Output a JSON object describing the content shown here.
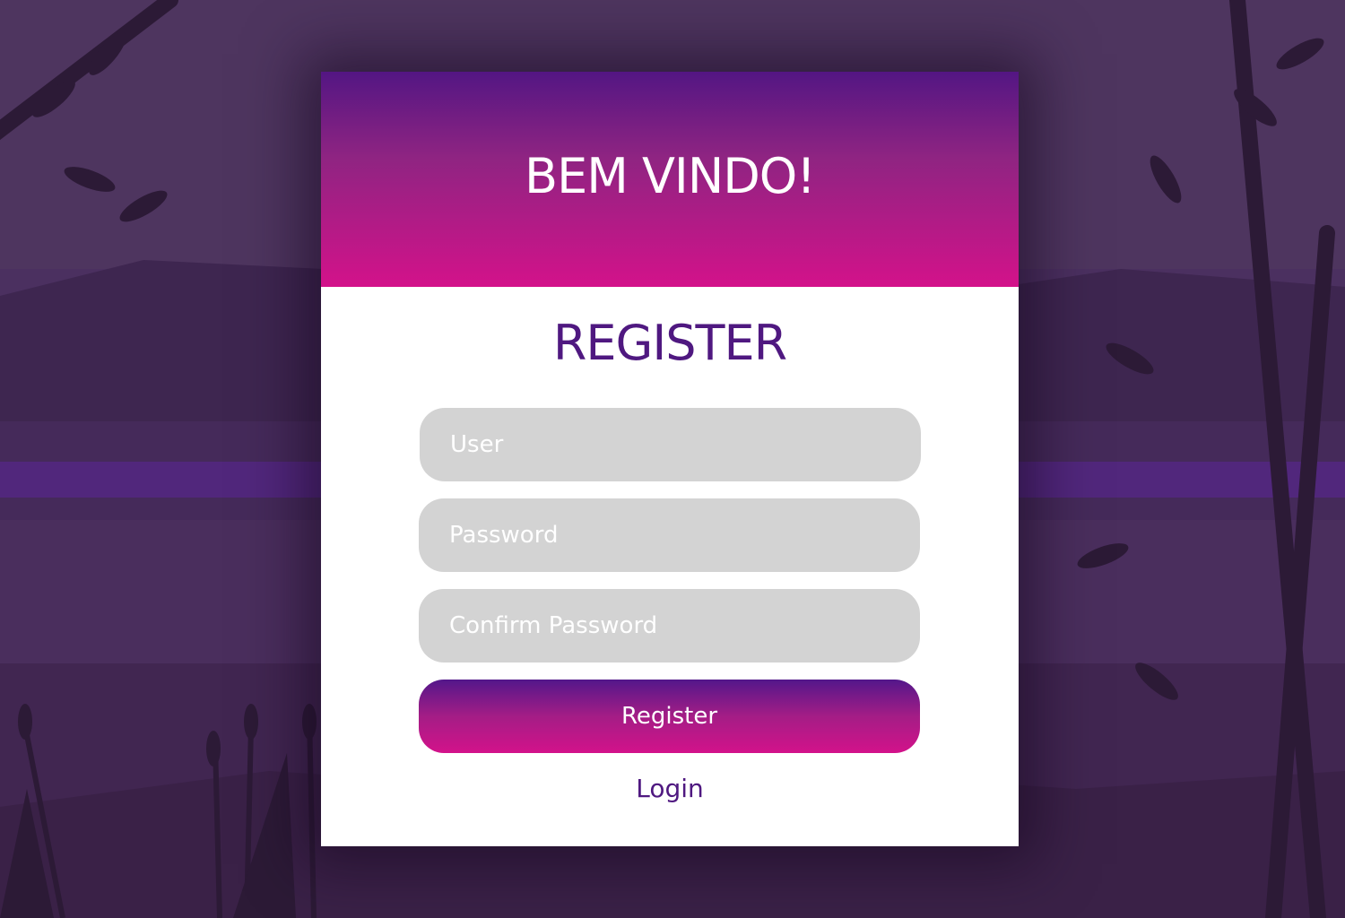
{
  "colors": {
    "background": "#4a2f5c",
    "header_gradient_top": "#531683",
    "header_gradient_bottom": "#d3128a",
    "title_text": "#4f1880",
    "input_background": "#d3d3d3",
    "card_background": "#ffffff"
  },
  "header": {
    "welcome_text": "BEM VINDO!"
  },
  "form": {
    "title": "REGISTER",
    "user_placeholder": "User",
    "password_placeholder": "Password",
    "confirm_password_placeholder": "Confirm Password",
    "submit_label": "Register",
    "login_link_label": "Login"
  }
}
